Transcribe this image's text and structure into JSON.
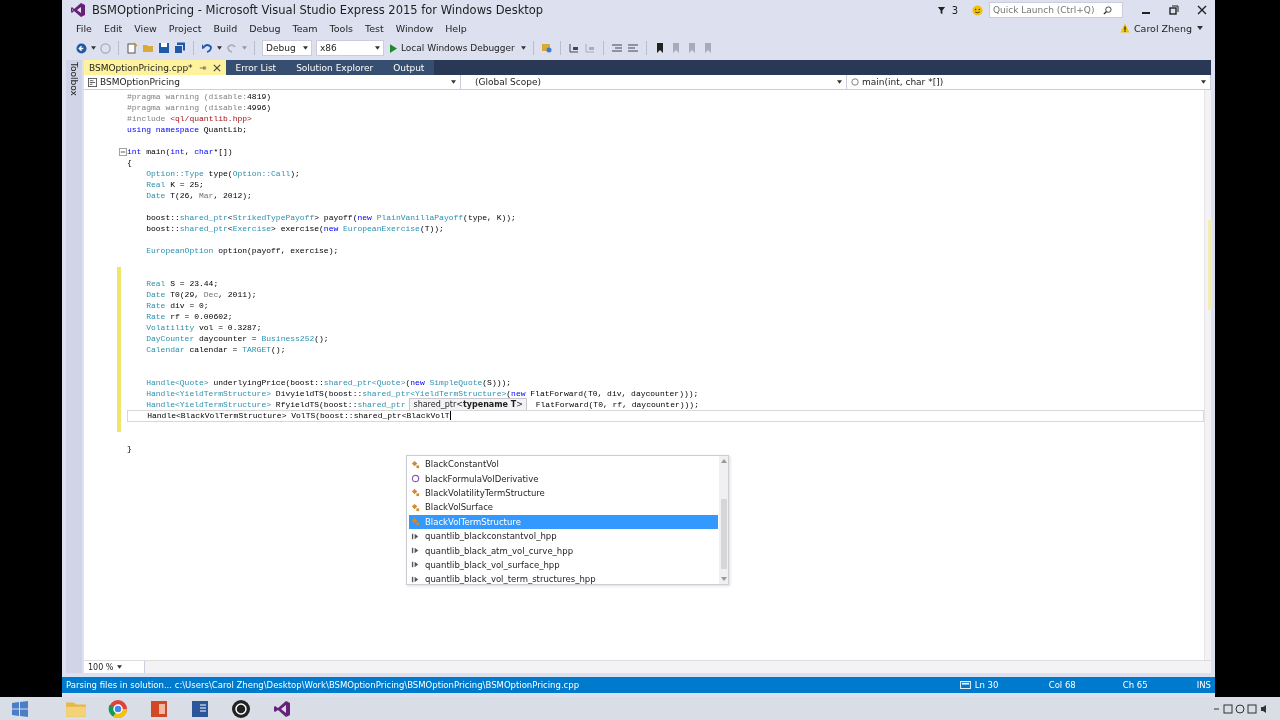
{
  "window": {
    "title": "BSMOptionPricing - Microsoft Visual Studio Express 2015 for Windows Desktop",
    "notifications": "3",
    "quick_launch": {
      "placeholder": "Quick Launch (Ctrl+Q)"
    },
    "user": "Carol Zheng"
  },
  "menu": [
    "File",
    "Edit",
    "View",
    "Project",
    "Build",
    "Debug",
    "Team",
    "Tools",
    "Test",
    "Window",
    "Help"
  ],
  "toolbar": {
    "configuration": "Debug",
    "platform": "x86",
    "run_label": "Local Windows Debugger"
  },
  "toolbox": "Toolbox",
  "tabs": [
    {
      "label": "BSMOptionPricing.cpp*",
      "selected": true
    },
    {
      "label": "Error List",
      "selected": false
    },
    {
      "label": "Solution Explorer",
      "selected": false
    },
    {
      "label": "Output",
      "selected": false
    }
  ],
  "navbar": {
    "project": "BSMOptionPricing",
    "scope": "(Global Scope)",
    "member": "main(int, char *[])"
  },
  "code": [
    {
      "kind": "code",
      "modified": false,
      "tokens": [
        {
          "text": "#pragma warning (disable:",
          "kind": "pre"
        },
        {
          "text": "4819)",
          "kind": "plain"
        }
      ]
    },
    {
      "kind": "code",
      "modified": false,
      "tokens": [
        {
          "text": "#pragma warning (disable:",
          "kind": "pre"
        },
        {
          "text": "4996)",
          "kind": "plain"
        }
      ]
    },
    {
      "kind": "code",
      "modified": false,
      "tokens": [
        {
          "text": "#include ",
          "kind": "pre"
        },
        {
          "text": "<ql/quantlib.hpp>",
          "kind": "str"
        }
      ]
    },
    {
      "kind": "code",
      "modified": false,
      "tokens": [
        {
          "text": "using namespace",
          "kind": "kw"
        },
        {
          "text": " QuantLib;",
          "kind": "plain"
        }
      ]
    },
    {
      "kind": "blank",
      "modified": false
    },
    {
      "kind": "code",
      "modified": false,
      "fold": true,
      "tokens": [
        {
          "text": "int",
          "kind": "kw"
        },
        {
          "text": " main(",
          "kind": "plain"
        },
        {
          "text": "int",
          "kind": "kw"
        },
        {
          "text": ", ",
          "kind": "plain"
        },
        {
          "text": "char",
          "kind": "kw"
        },
        {
          "text": "*[])",
          "kind": "plain"
        }
      ]
    },
    {
      "kind": "code",
      "modified": false,
      "tokens": [
        {
          "text": "{",
          "kind": "plain"
        }
      ]
    },
    {
      "kind": "code",
      "modified": false,
      "tokens": [
        {
          "text": "    Option::Type",
          "kind": "type"
        },
        {
          "text": " type(",
          "kind": "plain"
        },
        {
          "text": "Option::Call",
          "kind": "type"
        },
        {
          "text": ");",
          "kind": "plain"
        }
      ]
    },
    {
      "kind": "code",
      "modified": false,
      "tokens": [
        {
          "text": "    Real",
          "kind": "type"
        },
        {
          "text": " K = 25;",
          "kind": "plain"
        }
      ]
    },
    {
      "kind": "code",
      "modified": false,
      "tokens": [
        {
          "text": "    Date",
          "kind": "type"
        },
        {
          "text": " T(26, ",
          "kind": "plain"
        },
        {
          "text": "Mar",
          "kind": "enum"
        },
        {
          "text": ", 2012);",
          "kind": "plain"
        }
      ]
    },
    {
      "kind": "blank",
      "modified": false
    },
    {
      "kind": "code",
      "modified": false,
      "tokens": [
        {
          "text": "    boost::",
          "kind": "plain"
        },
        {
          "text": "shared_ptr",
          "kind": "type"
        },
        {
          "text": "<",
          "kind": "plain"
        },
        {
          "text": "StrikedTypePayoff",
          "kind": "type"
        },
        {
          "text": "> payoff(",
          "kind": "plain"
        },
        {
          "text": "new ",
          "kind": "kw"
        },
        {
          "text": "PlainVanillaPayoff",
          "kind": "type"
        },
        {
          "text": "(type, K));",
          "kind": "plain"
        }
      ]
    },
    {
      "kind": "code",
      "modified": false,
      "tokens": [
        {
          "text": "    boost::",
          "kind": "plain"
        },
        {
          "text": "shared_ptr",
          "kind": "type"
        },
        {
          "text": "<",
          "kind": "plain"
        },
        {
          "text": "Exercise",
          "kind": "type"
        },
        {
          "text": "> exercise(",
          "kind": "plain"
        },
        {
          "text": "new ",
          "kind": "kw"
        },
        {
          "text": "EuropeanExercise",
          "kind": "type"
        },
        {
          "text": "(T));",
          "kind": "plain"
        }
      ]
    },
    {
      "kind": "blank",
      "modified": false
    },
    {
      "kind": "code",
      "modified": false,
      "tokens": [
        {
          "text": "    EuropeanOption",
          "kind": "type"
        },
        {
          "text": " option(payoff, exercise);",
          "kind": "plain"
        }
      ]
    },
    {
      "kind": "blank",
      "modified": false
    },
    {
      "kind": "blank",
      "modified": true
    },
    {
      "kind": "code",
      "modified": true,
      "tokens": [
        {
          "text": "    Real",
          "kind": "type"
        },
        {
          "text": " S = 23.44;",
          "kind": "plain"
        }
      ]
    },
    {
      "kind": "code",
      "modified": true,
      "tokens": [
        {
          "text": "    Date",
          "kind": "type"
        },
        {
          "text": " T0(29, ",
          "kind": "plain"
        },
        {
          "text": "Dec",
          "kind": "enum"
        },
        {
          "text": ", 2011);",
          "kind": "plain"
        }
      ]
    },
    {
      "kind": "code",
      "modified": true,
      "tokens": [
        {
          "text": "    Rate",
          "kind": "type"
        },
        {
          "text": " div = 0;",
          "kind": "plain"
        }
      ]
    },
    {
      "kind": "code",
      "modified": true,
      "tokens": [
        {
          "text": "    Rate",
          "kind": "type"
        },
        {
          "text": " rf = 0.00602;",
          "kind": "plain"
        }
      ]
    },
    {
      "kind": "code",
      "modified": true,
      "tokens": [
        {
          "text": "    Volatility",
          "kind": "type"
        },
        {
          "text": " vol = 0.3287;",
          "kind": "plain"
        }
      ]
    },
    {
      "kind": "code",
      "modified": true,
      "tokens": [
        {
          "text": "    DayCounter",
          "kind": "type"
        },
        {
          "text": " daycounter = ",
          "kind": "plain"
        },
        {
          "text": "Business252",
          "kind": "type"
        },
        {
          "text": "();",
          "kind": "plain"
        }
      ]
    },
    {
      "kind": "code",
      "modified": true,
      "tokens": [
        {
          "text": "    Calendar",
          "kind": "type"
        },
        {
          "text": " calendar = ",
          "kind": "plain"
        },
        {
          "text": "TARGET",
          "kind": "type"
        },
        {
          "text": "();",
          "kind": "plain"
        }
      ]
    },
    {
      "kind": "blank",
      "modified": true
    },
    {
      "kind": "blank",
      "modified": true
    },
    {
      "kind": "code",
      "modified": true,
      "tokens": [
        {
          "text": "    Handle<Quote>",
          "kind": "type"
        },
        {
          "text": " underlyingPrice(boost::",
          "kind": "plain"
        },
        {
          "text": "shared_ptr<Quote>",
          "kind": "type"
        },
        {
          "text": "(",
          "kind": "plain"
        },
        {
          "text": "new ",
          "kind": "kw"
        },
        {
          "text": "SimpleQuote",
          "kind": "type"
        },
        {
          "text": "(S)));",
          "kind": "plain"
        }
      ]
    },
    {
      "kind": "code",
      "modified": true,
      "tokens": [
        {
          "text": "    Handle<YieldTermStructure>",
          "kind": "type"
        },
        {
          "text": " DivyieldTS(boost::",
          "kind": "plain"
        },
        {
          "text": "shared_ptr<YieldTermStructure>",
          "kind": "type"
        },
        {
          "text": "(",
          "kind": "plain"
        },
        {
          "text": "new",
          "kind": "kw"
        },
        {
          "text": " FlatForward(T0, div, daycounter)));",
          "kind": "plain"
        }
      ]
    },
    {
      "kind": "code",
      "modified": true,
      "tokens": [
        {
          "text": "    Handle<YieldTermStructure>",
          "kind": "type"
        },
        {
          "text": " RfyieldTS(boost::",
          "kind": "plain"
        },
        {
          "text": "shared_ptr",
          "kind": "type"
        }
      ],
      "tooltip": "shared_ptr<**typename T**>",
      "after": [
        {
          "text": " FlatForward(T0, rf, daycounter)));",
          "kind": "plain"
        }
      ]
    },
    {
      "kind": "code",
      "modified": true,
      "current": true,
      "tokens": [
        {
          "text": "    Handle<BlackVolTermStructure> VolTS(boost::shared_ptr<BlackVolT",
          "kind": "plain"
        }
      ]
    },
    {
      "kind": "blank",
      "modified": true
    },
    {
      "kind": "blank",
      "modified": false
    },
    {
      "kind": "code",
      "modified": false,
      "tokens": [
        {
          "text": "}",
          "kind": "plain"
        }
      ]
    }
  ],
  "completion": [
    {
      "label": "BlackConstantVol",
      "kind": "class",
      "selected": false
    },
    {
      "label": "blackFormulaVolDerivative",
      "kind": "function",
      "selected": false
    },
    {
      "label": "BlackVolatilityTermStructure",
      "kind": "class",
      "selected": false
    },
    {
      "label": "BlackVolSurface",
      "kind": "class",
      "selected": false
    },
    {
      "label": "BlackVolTermStructure",
      "kind": "class",
      "selected": true
    },
    {
      "label": "quantlib_blackconstantvol_hpp",
      "kind": "macro",
      "selected": false
    },
    {
      "label": "quantlib_black_atm_vol_curve_hpp",
      "kind": "macro",
      "selected": false
    },
    {
      "label": "quantlib_black_vol_surface_hpp",
      "kind": "macro",
      "selected": false
    },
    {
      "label": "quantlib_black_vol_term_structures_hpp",
      "kind": "macro",
      "selected": false
    }
  ],
  "zoom": "100 %",
  "status_bar": {
    "message": "Parsing files in solution... c:\\Users\\Carol Zheng\\Desktop\\Work\\BSMOptionPricing\\BSMOptionPricing\\BSMOptionPricing.cpp",
    "line": "Ln 30",
    "column": "Col 68",
    "char": "Ch 65",
    "mode": "INS"
  },
  "taskbar": [
    {
      "kind": "start"
    },
    {
      "kind": "folder"
    },
    {
      "kind": "browser"
    },
    {
      "kind": "slides"
    },
    {
      "kind": "document"
    },
    {
      "kind": "recorder"
    },
    {
      "kind": "ide"
    }
  ]
}
